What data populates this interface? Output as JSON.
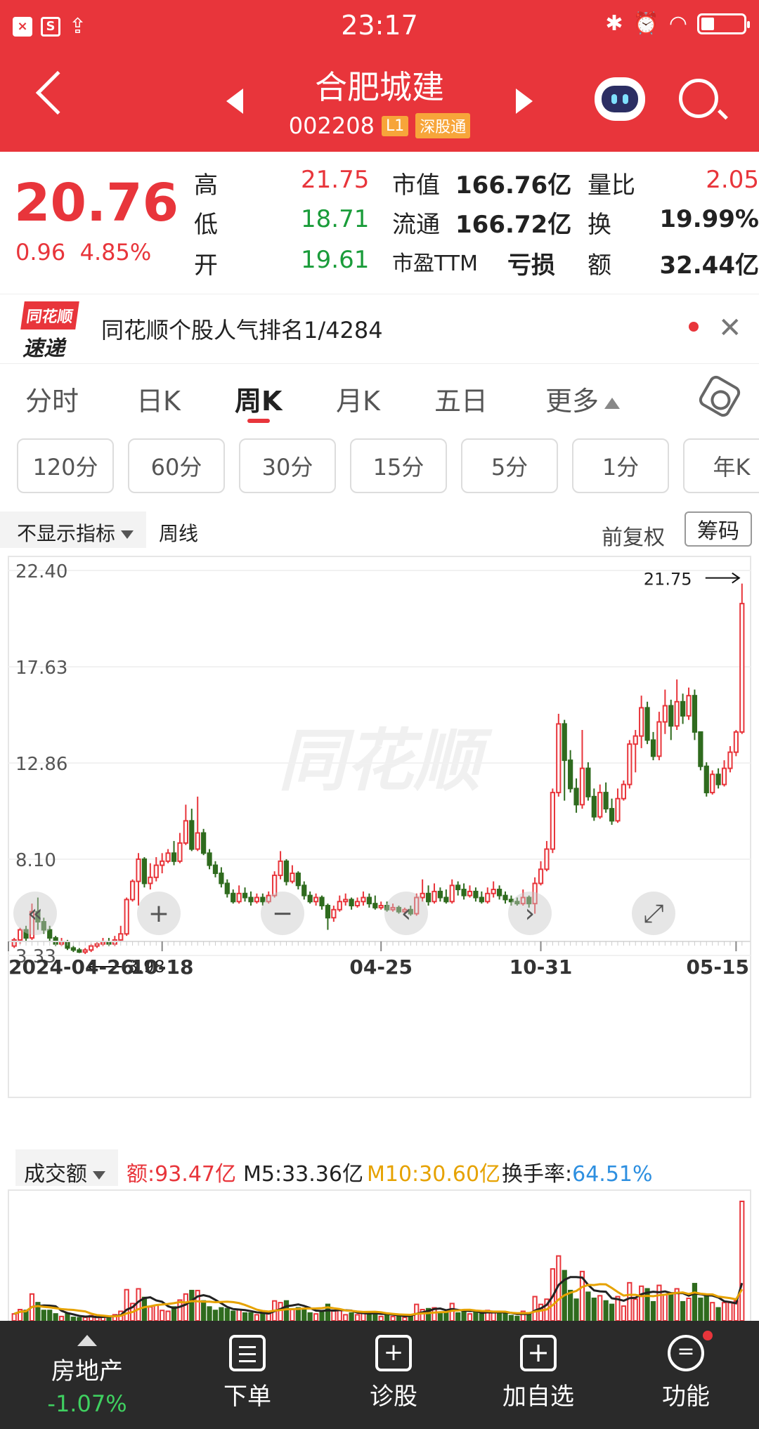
{
  "status": {
    "time": "23:17",
    "left_icons": [
      "close-app-icon",
      "s-app-icon",
      "upload-icon"
    ]
  },
  "header": {
    "name": "合肥城建",
    "code": "002208",
    "tags": [
      "L1",
      "深股通"
    ]
  },
  "quote": {
    "price": "20.76",
    "change": "0.96",
    "change_pct": "4.85%",
    "rows": [
      [
        {
          "label": "高",
          "value": "21.75",
          "color": "red"
        },
        {
          "label": "市值",
          "value": "166.76亿"
        },
        {
          "label": "量比",
          "value": "2.05",
          "color": "red"
        }
      ],
      [
        {
          "label": "低",
          "value": "18.71",
          "color": "green"
        },
        {
          "label": "流通",
          "value": "166.72亿"
        },
        {
          "label": "换",
          "value": "19.99%"
        }
      ],
      [
        {
          "label": "开",
          "value": "19.61",
          "color": "green"
        },
        {
          "label": "市盈TTM",
          "value": "亏损"
        },
        {
          "label": "额",
          "value": "32.44亿"
        }
      ]
    ]
  },
  "banner": {
    "logo_top": "同花顺",
    "logo_bottom": "速递",
    "text": "同花顺个股人气排名1/4284"
  },
  "tabs": [
    "分时",
    "日K",
    "周K",
    "月K",
    "五日",
    "更多"
  ],
  "active_tab": 2,
  "intervals": [
    "120分",
    "60分",
    "30分",
    "15分",
    "5分",
    "1分",
    "年K"
  ],
  "chart_head": {
    "indicator": "不显示指标",
    "period": "周线",
    "adjust": "前复权",
    "chips": "筹码"
  },
  "chart_data": {
    "type": "candlestick",
    "y_ticks": [
      "22.40",
      "17.63",
      "12.86",
      "8.10",
      "3.33"
    ],
    "ylim": [
      3.33,
      22.4
    ],
    "x_ticks": [
      "2024-04-26",
      "10-18",
      "04-25",
      "10-31",
      "05-15"
    ],
    "x_tick_index": [
      0,
      25,
      62,
      89,
      122
    ],
    "high_label": "21.75",
    "low_label": "3.98",
    "watermark": "同花顺",
    "candles": [
      [
        3.8,
        4.1,
        3.7,
        4.2
      ],
      [
        4.1,
        4.6,
        3.9,
        4.7
      ],
      [
        4.6,
        4.2,
        4.0,
        4.8
      ],
      [
        4.2,
        5.5,
        4.1,
        5.9
      ],
      [
        5.5,
        5.0,
        4.6,
        6.2
      ],
      [
        5.0,
        4.6,
        4.4,
        5.2
      ],
      [
        4.6,
        4.2,
        4.0,
        4.8
      ],
      [
        4.2,
        3.9,
        3.8,
        4.3
      ],
      [
        3.9,
        4.0,
        3.8,
        4.2
      ],
      [
        4.0,
        3.7,
        3.6,
        4.1
      ],
      [
        3.7,
        3.6,
        3.5,
        3.8
      ],
      [
        3.6,
        3.5,
        3.45,
        3.7
      ],
      [
        3.5,
        3.6,
        3.4,
        3.7
      ],
      [
        3.6,
        3.8,
        3.5,
        3.9
      ],
      [
        3.8,
        3.9,
        3.7,
        4.0
      ],
      [
        3.9,
        4.0,
        3.8,
        4.2
      ],
      [
        4.0,
        3.9,
        3.8,
        4.2
      ],
      [
        3.9,
        4.1,
        3.8,
        4.3
      ],
      [
        4.1,
        4.4,
        4.0,
        4.8
      ],
      [
        4.4,
        6.1,
        4.3,
        6.2
      ],
      [
        6.1,
        7.0,
        6.0,
        7.1
      ],
      [
        7.0,
        8.1,
        5.8,
        8.4
      ],
      [
        8.1,
        6.9,
        6.7,
        8.2
      ],
      [
        6.9,
        7.2,
        6.6,
        7.9
      ],
      [
        7.2,
        7.8,
        7.0,
        8.2
      ],
      [
        7.8,
        8.0,
        7.4,
        8.4
      ],
      [
        8.0,
        8.4,
        7.9,
        8.6
      ],
      [
        8.4,
        8.0,
        7.8,
        9.0
      ],
      [
        8.0,
        8.9,
        7.9,
        9.4
      ],
      [
        8.9,
        10.0,
        8.8,
        10.8
      ],
      [
        10.0,
        8.6,
        8.5,
        10.6
      ],
      [
        8.6,
        9.4,
        8.5,
        11.2
      ],
      [
        9.4,
        8.4,
        8.3,
        9.6
      ],
      [
        8.4,
        7.8,
        7.6,
        8.6
      ],
      [
        7.8,
        7.4,
        7.2,
        8.0
      ],
      [
        7.4,
        6.9,
        6.7,
        7.7
      ],
      [
        6.9,
        6.4,
        6.2,
        7.1
      ],
      [
        6.4,
        6.0,
        5.9,
        6.6
      ],
      [
        6.0,
        6.4,
        5.9,
        6.8
      ],
      [
        6.4,
        6.2,
        6.0,
        6.7
      ],
      [
        6.2,
        6.0,
        5.8,
        6.5
      ],
      [
        6.0,
        6.2,
        5.9,
        6.4
      ],
      [
        6.2,
        6.0,
        5.8,
        6.4
      ],
      [
        6.0,
        6.3,
        5.9,
        6.5
      ],
      [
        6.3,
        7.3,
        6.2,
        7.5
      ],
      [
        7.3,
        8.0,
        7.1,
        8.5
      ],
      [
        8.0,
        7.0,
        6.8,
        8.1
      ],
      [
        7.0,
        7.4,
        6.9,
        7.8
      ],
      [
        7.4,
        6.8,
        6.6,
        7.5
      ],
      [
        6.8,
        6.3,
        6.1,
        7.0
      ],
      [
        6.3,
        6.0,
        5.9,
        6.5
      ],
      [
        6.0,
        6.2,
        5.8,
        6.4
      ],
      [
        6.2,
        5.8,
        5.6,
        6.3
      ],
      [
        5.8,
        5.2,
        4.6,
        5.9
      ],
      [
        5.2,
        5.6,
        5.0,
        5.8
      ],
      [
        5.6,
        6.0,
        5.5,
        6.3
      ],
      [
        6.0,
        6.1,
        5.8,
        6.4
      ],
      [
        6.1,
        5.8,
        5.6,
        6.2
      ],
      [
        5.8,
        6.0,
        5.7,
        6.2
      ],
      [
        6.0,
        6.2,
        5.8,
        6.5
      ],
      [
        6.2,
        5.9,
        5.7,
        6.4
      ],
      [
        5.9,
        5.7,
        5.6,
        6.3
      ],
      [
        5.7,
        5.8,
        5.6,
        6.0
      ],
      [
        5.8,
        5.6,
        5.5,
        6.0
      ],
      [
        5.6,
        5.7,
        5.5,
        5.9
      ],
      [
        5.7,
        5.5,
        5.4,
        5.8
      ],
      [
        5.5,
        5.6,
        5.4,
        5.7
      ],
      [
        5.6,
        5.4,
        5.3,
        5.8
      ],
      [
        5.4,
        6.2,
        5.3,
        6.4
      ],
      [
        6.2,
        6.4,
        6.0,
        7.1
      ],
      [
        6.4,
        6.0,
        5.8,
        6.8
      ],
      [
        6.0,
        6.5,
        5.9,
        6.9
      ],
      [
        6.5,
        6.2,
        6.0,
        6.7
      ],
      [
        6.2,
        6.0,
        5.9,
        6.6
      ],
      [
        6.0,
        6.8,
        5.9,
        7.1
      ],
      [
        6.8,
        6.6,
        6.3,
        7.0
      ],
      [
        6.6,
        6.3,
        6.1,
        6.9
      ],
      [
        6.3,
        6.5,
        6.2,
        6.8
      ],
      [
        6.5,
        6.2,
        6.0,
        6.7
      ],
      [
        6.2,
        6.0,
        5.9,
        6.5
      ],
      [
        6.0,
        6.4,
        5.9,
        6.7
      ],
      [
        6.4,
        6.6,
        6.2,
        7.0
      ],
      [
        6.6,
        6.3,
        6.1,
        6.8
      ],
      [
        6.3,
        6.1,
        5.9,
        6.5
      ],
      [
        6.1,
        6.0,
        5.8,
        6.3
      ],
      [
        6.0,
        5.9,
        5.8,
        6.2
      ],
      [
        5.9,
        6.2,
        5.8,
        6.6
      ],
      [
        6.2,
        5.9,
        5.7,
        6.3
      ],
      [
        5.9,
        6.9,
        5.4,
        7.2
      ],
      [
        6.9,
        7.6,
        6.8,
        8.0
      ],
      [
        7.6,
        8.6,
        7.5,
        9.0
      ],
      [
        8.6,
        11.4,
        8.4,
        11.6
      ],
      [
        11.4,
        14.8,
        11.2,
        15.3
      ],
      [
        14.8,
        13.0,
        11.0,
        15.0
      ],
      [
        13.0,
        11.6,
        11.4,
        13.5
      ],
      [
        11.6,
        10.8,
        10.4,
        12.1
      ],
      [
        10.8,
        12.6,
        10.6,
        14.5
      ],
      [
        12.6,
        11.2,
        11.0,
        12.9
      ],
      [
        11.2,
        10.2,
        10.0,
        11.6
      ],
      [
        10.2,
        11.4,
        10.1,
        11.8
      ],
      [
        11.4,
        10.6,
        10.4,
        11.9
      ],
      [
        10.6,
        10.0,
        9.8,
        11.1
      ],
      [
        10.0,
        11.1,
        9.9,
        11.6
      ],
      [
        11.1,
        11.8,
        11.0,
        12.0
      ],
      [
        11.8,
        13.8,
        11.6,
        14.0
      ],
      [
        13.8,
        14.2,
        12.4,
        14.5
      ],
      [
        14.2,
        15.6,
        13.6,
        16.2
      ],
      [
        15.6,
        14.0,
        13.8,
        15.9
      ],
      [
        14.0,
        13.2,
        13.0,
        14.4
      ],
      [
        13.2,
        14.9,
        13.0,
        15.4
      ],
      [
        14.9,
        15.7,
        14.3,
        16.5
      ],
      [
        15.7,
        14.7,
        14.0,
        16.0
      ],
      [
        14.7,
        15.9,
        14.5,
        17.0
      ],
      [
        15.9,
        15.2,
        14.8,
        16.3
      ],
      [
        15.2,
        16.2,
        15.0,
        16.6
      ],
      [
        16.2,
        14.4,
        14.0,
        16.5
      ],
      [
        14.4,
        12.7,
        12.5,
        13.4
      ],
      [
        12.7,
        11.4,
        11.2,
        12.9
      ],
      [
        11.4,
        12.3,
        11.3,
        12.5
      ],
      [
        12.3,
        11.8,
        11.6,
        12.6
      ],
      [
        11.8,
        12.6,
        11.7,
        13.0
      ],
      [
        12.6,
        13.4,
        12.4,
        13.7
      ],
      [
        13.4,
        14.4,
        13.2,
        14.5
      ],
      [
        14.4,
        20.76,
        14.3,
        21.75
      ]
    ]
  },
  "volume": {
    "selector": "成交额",
    "amount_label": "额:",
    "amount": "93.47亿",
    "m5": "M5:33.36亿",
    "m10_label": "M10:",
    "m10": "30.60亿",
    "turnover_label": "换手率:",
    "turnover": "64.51%",
    "colors": {
      "m5": "#222222",
      "m10": "#e6a200",
      "turnover": "#2d8fe0"
    }
  },
  "bottom_nav": {
    "sector": {
      "name": "房地产",
      "change": "-1.07%"
    },
    "items": [
      "下单",
      "诊股",
      "加自选",
      "功能"
    ]
  },
  "colors": {
    "up": "#e8353b",
    "down": "#2f6b1e",
    "header": "#e8353b"
  }
}
